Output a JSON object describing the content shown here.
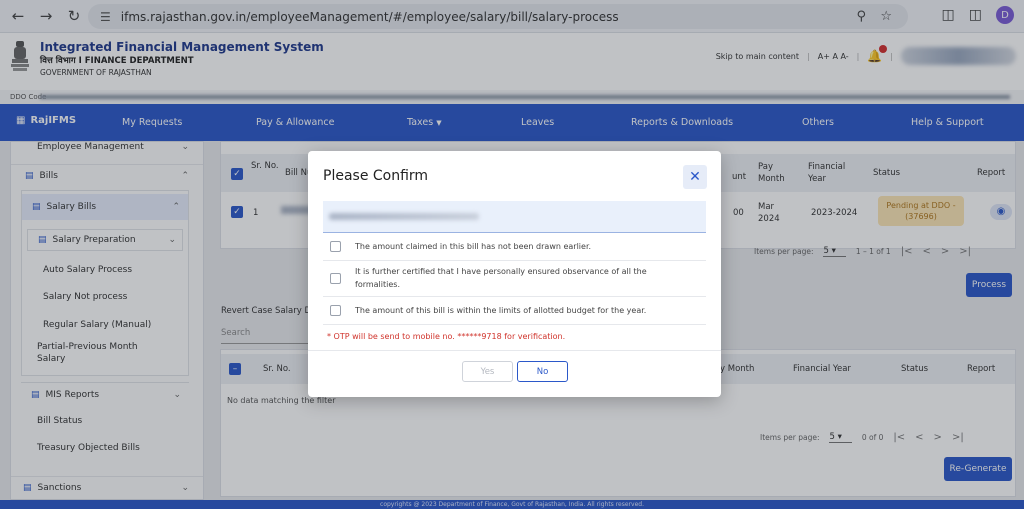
{
  "browser": {
    "url": "ifms.rajasthan.gov.in/employeeManagement/#/employee/salary/bill/salary-process",
    "profile_initial": "D"
  },
  "header": {
    "title": "Integrated Financial Management System",
    "dept": "वित्त विभाग  I  FINANCE DEPARTMENT",
    "gov": "GOVERNMENT OF RAJASTHAN",
    "skip": "Skip to main content",
    "font_controls": "A+  A  A-",
    "ddo_label": "DDO Code"
  },
  "nav": {
    "brand": "RajIFMS",
    "items": [
      "My Requests",
      "Pay & Allowance",
      "Taxes",
      "Leaves",
      "Reports & Downloads",
      "Others",
      "Help & Support"
    ]
  },
  "sidebar": {
    "employee_mgmt": "Employee Management",
    "bills": "Bills",
    "salary_bills": "Salary Bills",
    "salary_prep": "Salary Preparation",
    "sub_items": [
      "Auto Salary Process",
      "Salary Not process",
      "Regular Salary (Manual)",
      "Partial-Previous Month Salary"
    ],
    "mis_reports": "MIS Reports",
    "bill_status": "Bill Status",
    "treasury_objected": "Treasury Objected Bills",
    "sanctions": "Sanctions"
  },
  "top_table": {
    "headers": [
      "Sr. No.",
      "Bill Nu",
      "unt",
      "Pay Month",
      "Financial Year",
      "Status",
      "Report"
    ],
    "row": {
      "sr": "1",
      "amount_partial": "00",
      "pay_month": "Mar 2024",
      "fin_year": "2023-2024",
      "status": "Pending at DDO - (37696)"
    },
    "pager": {
      "items_label": "Items per page:",
      "page_size": "5",
      "range": "1 – 1 of 1"
    },
    "process_btn": "Process"
  },
  "revert": {
    "title": "Revert Case Salary D",
    "search_label": "Search"
  },
  "bottom_table": {
    "headers": [
      "Sr. No.",
      "y Month",
      "Financial Year",
      "Status",
      "Report"
    ],
    "empty": "No data matching the filter",
    "pager": {
      "items_label": "Items per page:",
      "page_size": "5",
      "range": "0 of 0"
    },
    "regenerate_btn": "Re-Generate"
  },
  "footer": {
    "text": "copyrights @ 2023 Department of Finance, Govt of Rajasthan, India. All rights reserved."
  },
  "modal": {
    "title": "Please Confirm",
    "checks": [
      "The amount claimed in this bill has not been drawn earlier.",
      "It is further certified that I have personally ensured observance of all the formalities.",
      "The amount of this bill is within the limits of allotted budget for the year."
    ],
    "otp_note": "* OTP will be send to mobile no. ******9718 for verification.",
    "yes": "Yes",
    "no": "No"
  }
}
